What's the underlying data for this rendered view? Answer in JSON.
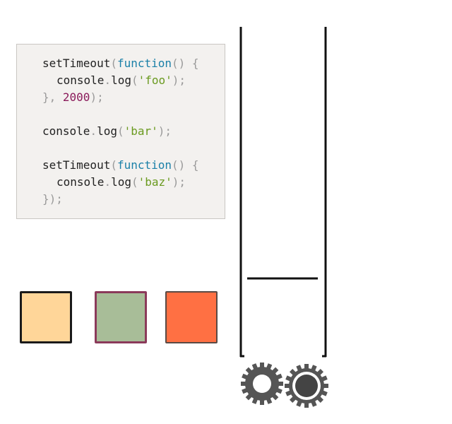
{
  "code": {
    "lines": [
      {
        "tokens": [
          {
            "text": "setTimeout",
            "kind": "plain"
          },
          {
            "text": "(",
            "kind": "punct"
          },
          {
            "text": "function",
            "kind": "keyword"
          },
          {
            "text": "() {",
            "kind": "punct"
          }
        ],
        "indent": false
      },
      {
        "tokens": [
          {
            "text": "console",
            "kind": "plain"
          },
          {
            "text": ".",
            "kind": "punct"
          },
          {
            "text": "log",
            "kind": "plain"
          },
          {
            "text": "(",
            "kind": "punct"
          },
          {
            "text": "'foo'",
            "kind": "string"
          },
          {
            "text": ");",
            "kind": "punct"
          }
        ],
        "indent": true
      },
      {
        "tokens": [
          {
            "text": "}, ",
            "kind": "punct"
          },
          {
            "text": "2000",
            "kind": "number"
          },
          {
            "text": ");",
            "kind": "punct"
          }
        ],
        "indent": false
      },
      {
        "tokens": [],
        "indent": false
      },
      {
        "tokens": [
          {
            "text": "console",
            "kind": "plain"
          },
          {
            "text": ".",
            "kind": "punct"
          },
          {
            "text": "log",
            "kind": "plain"
          },
          {
            "text": "(",
            "kind": "punct"
          },
          {
            "text": "'bar'",
            "kind": "string"
          },
          {
            "text": ");",
            "kind": "punct"
          }
        ],
        "indent": false
      },
      {
        "tokens": [],
        "indent": false
      },
      {
        "tokens": [
          {
            "text": "setTimeout",
            "kind": "plain"
          },
          {
            "text": "(",
            "kind": "punct"
          },
          {
            "text": "function",
            "kind": "keyword"
          },
          {
            "text": "() {",
            "kind": "punct"
          }
        ],
        "indent": false
      },
      {
        "tokens": [
          {
            "text": "console",
            "kind": "plain"
          },
          {
            "text": ".",
            "kind": "punct"
          },
          {
            "text": "log",
            "kind": "plain"
          },
          {
            "text": "(",
            "kind": "punct"
          },
          {
            "text": "'baz'",
            "kind": "string"
          },
          {
            "text": ");",
            "kind": "punct"
          }
        ],
        "indent": true
      },
      {
        "tokens": [
          {
            "text": "});",
            "kind": "punct"
          }
        ],
        "indent": false
      }
    ]
  },
  "swatches": [
    {
      "fill": "#ffd699",
      "border": "#1a1a1a"
    },
    {
      "fill": "#a8bd98",
      "border": "#8b3a5a"
    },
    {
      "fill": "#ff7043",
      "border": "#5a4a44"
    }
  ],
  "stack": {
    "bracket_color": "#111111",
    "gear_color": "#555555",
    "gears": [
      {
        "name": "gear-left-icon",
        "style": "hollow-center"
      },
      {
        "name": "gear-right-icon",
        "style": "ringed-center"
      }
    ]
  }
}
